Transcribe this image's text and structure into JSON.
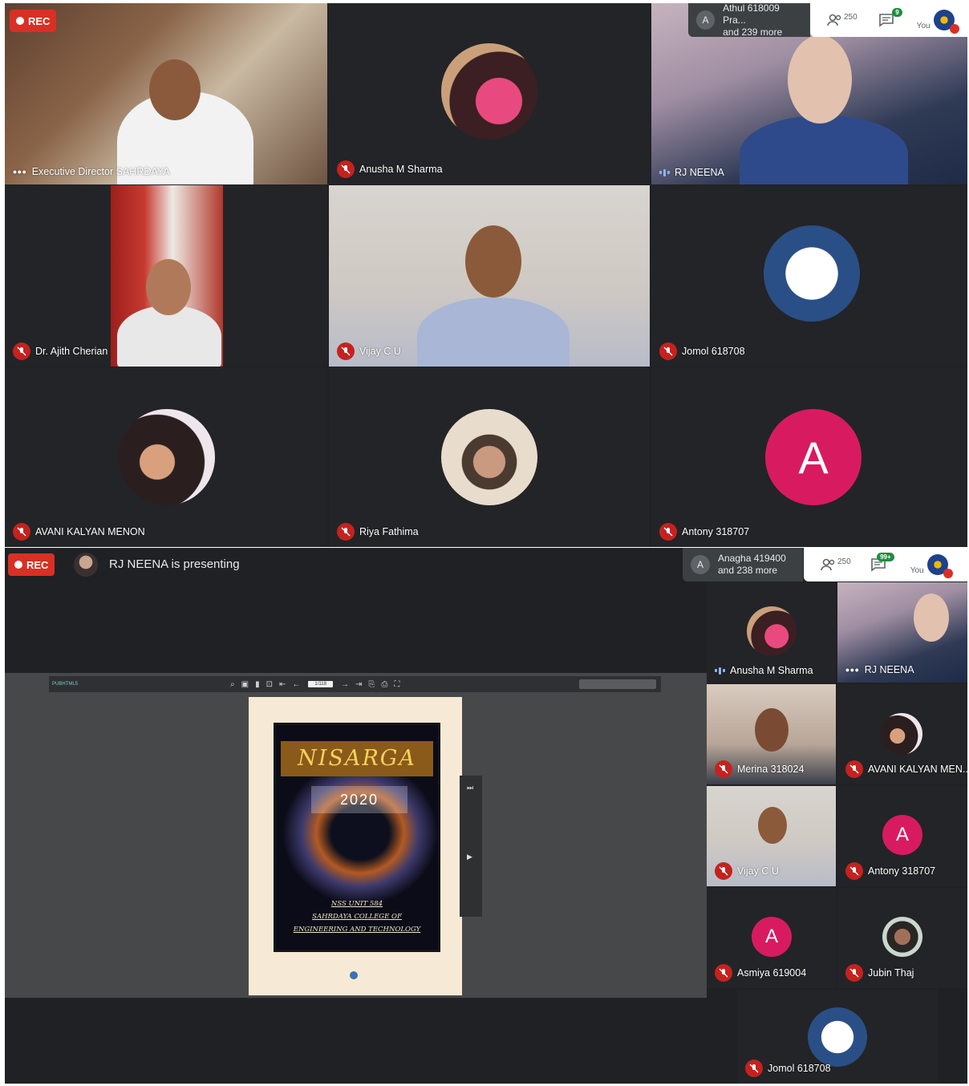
{
  "top_meeting": {
    "rec_label": "REC",
    "more_box": {
      "avatar_letter": "A",
      "line1": "Athul 618009 Pra...",
      "line2": "and 239 more"
    },
    "toolbar": {
      "people_count": "250",
      "chat_badge": "9",
      "self_label": "You"
    },
    "tiles": [
      {
        "name": "Executive Director SAHRDAYA"
      },
      {
        "name": "Anusha M Sharma"
      },
      {
        "name": "RJ NEENA"
      },
      {
        "name": "Dr. Ajith Cherian"
      },
      {
        "name": "Vijay C U"
      },
      {
        "name": "Jomol 618708"
      },
      {
        "name": "AVANI KALYAN MENON"
      },
      {
        "name": "Riya Fathima"
      },
      {
        "name": "Antony 318707",
        "avatar_letter": "A"
      }
    ]
  },
  "bottom_meeting": {
    "rec_label": "REC",
    "presenting_text": "RJ NEENA is presenting",
    "more_box": {
      "avatar_letter": "A",
      "line1": "Anagha 419400",
      "line2": "and 238 more"
    },
    "toolbar": {
      "people_count": "250",
      "chat_badge": "99+",
      "self_label": "You"
    },
    "viewer": {
      "brand": "PUBHTML5",
      "page_indicator": "1/118",
      "cover": {
        "title": "NISARGA",
        "year": "2020",
        "line1": "NSS UNIT 584",
        "line2": "SAHRDAYA COLLEGE OF",
        "line3": "ENGINEERING AND TECHNOLOGY"
      }
    },
    "tiles": [
      {
        "name": "Anusha M Sharma"
      },
      {
        "name": "RJ NEENA"
      },
      {
        "name": "Merina 318024"
      },
      {
        "name": "AVANI KALYAN MEN..."
      },
      {
        "name": "Vijay C U"
      },
      {
        "name": "Antony 318707",
        "avatar_letter": "A"
      },
      {
        "name": "Asmiya 619004",
        "avatar_letter": "A"
      },
      {
        "name": "Jubin Thaj"
      },
      {
        "name": "Jomol 618708"
      }
    ]
  },
  "colors": {
    "meet_bg": "#202124",
    "rec_red": "#d93025",
    "mic_off_red": "#c5221f",
    "avatar_pink": "#d81b60"
  }
}
